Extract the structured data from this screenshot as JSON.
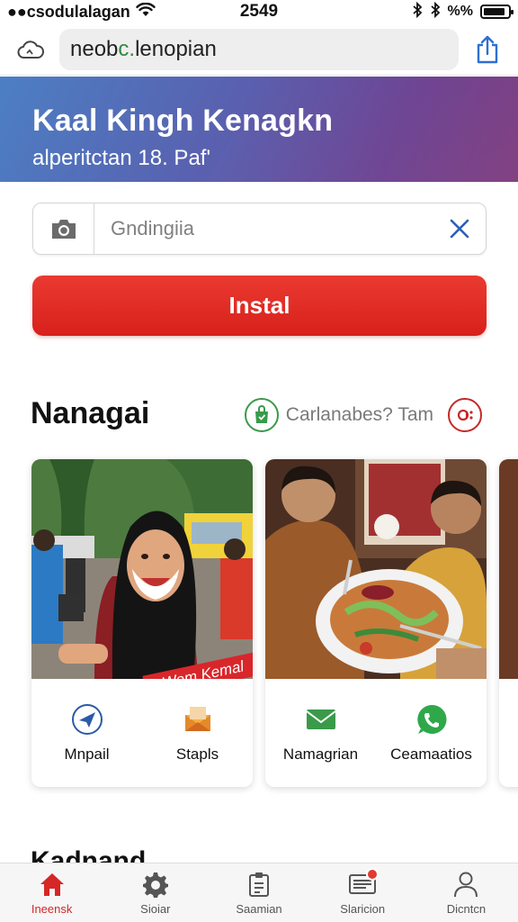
{
  "status_bar": {
    "carrier": "●●csodulalagan",
    "time": "2549",
    "battery_text": "%%",
    "battery_level": 0.9
  },
  "url_bar": {
    "url_prefix": "neob",
    "url_accent": "c.",
    "url_suffix": " lenopian"
  },
  "banner": {
    "title": "Kaal Kingh Kenagkn",
    "subtitle": "alperitctan 18. Paf'"
  },
  "search": {
    "placeholder": "Gndingiia"
  },
  "install_button": {
    "label": "Instal"
  },
  "section": {
    "title": "Nanagai",
    "tools_label": "Carlanabes? Tam"
  },
  "cards": [
    {
      "ribbon": "Wem Kemal",
      "actions": [
        {
          "label": "Mnpail",
          "icon": "send-icon"
        },
        {
          "label": "Stapls",
          "icon": "envelope-open-icon"
        }
      ]
    },
    {
      "actions": [
        {
          "label": "Namagrian",
          "icon": "mail-icon"
        },
        {
          "label": "Ceamaatios",
          "icon": "phone-chat-icon"
        }
      ]
    }
  ],
  "next_section": {
    "title": "Kadnand"
  },
  "bottom_nav": [
    {
      "label": "Ineensk",
      "icon": "home-icon",
      "active": true
    },
    {
      "label": "Sioiar",
      "icon": "gear-icon",
      "active": false
    },
    {
      "label": "Saamian",
      "icon": "clipboard-icon",
      "active": false
    },
    {
      "label": "Slaricion",
      "icon": "inbox-icon",
      "active": false
    },
    {
      "label": "Dicntcn",
      "icon": "profile-icon",
      "active": false
    }
  ],
  "colors": {
    "accent_red": "#d62626",
    "banner_start": "#4c7fc4",
    "banner_end": "#7a3579",
    "url_accent": "#2f8a3e"
  }
}
